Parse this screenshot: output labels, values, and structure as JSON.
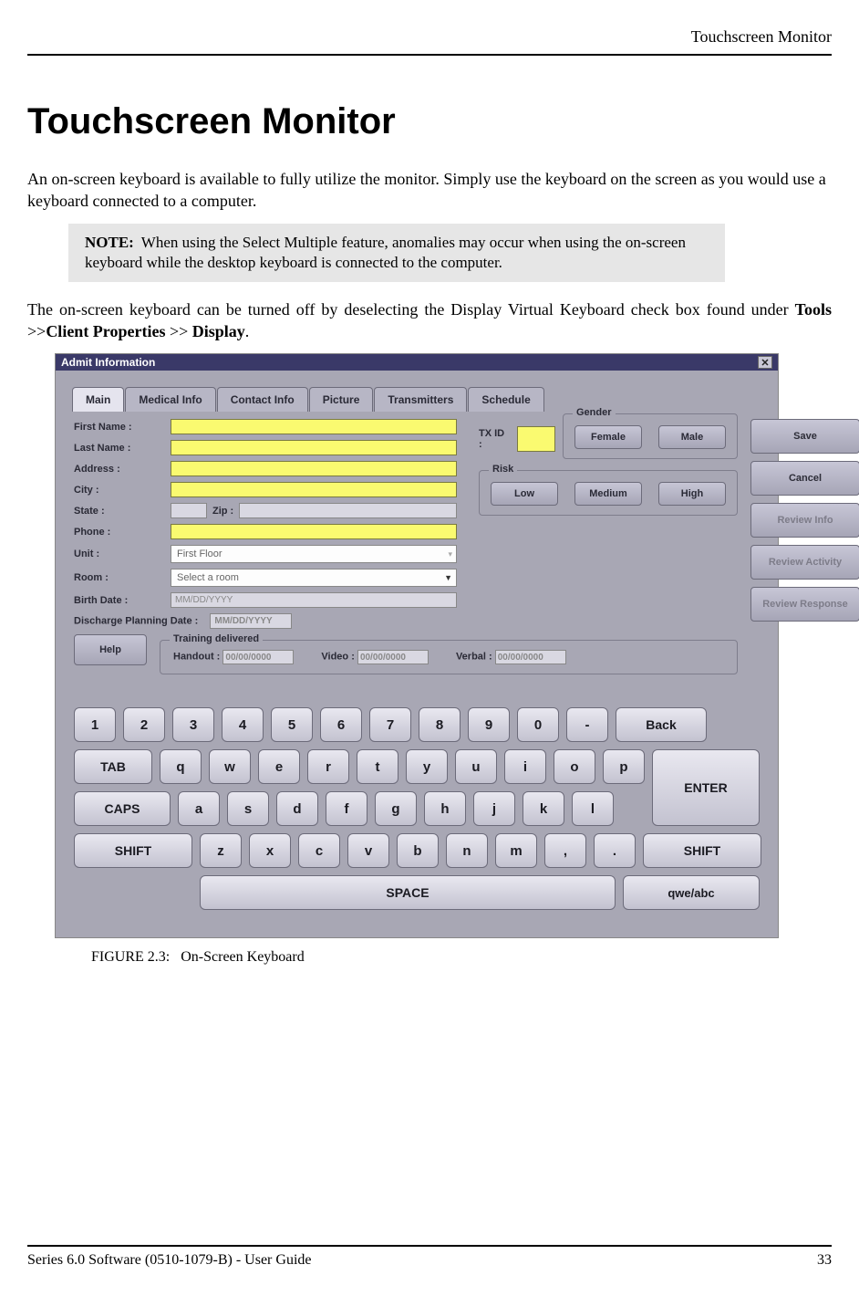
{
  "header": {
    "right": "Touchscreen Monitor"
  },
  "title": "Touchscreen Monitor",
  "intro": "An on-screen keyboard is available to fully utilize the monitor. Simply use the keyboard on the screen as you would use a keyboard connected to a computer.",
  "note": {
    "label": "NOTE:",
    "text": " When using the Select Multiple feature, anomalies may occur when using the on-screen keyboard while the desktop keyboard is connected to the computer."
  },
  "para2": {
    "pre": "The on-screen keyboard can be turned off by deselecting the Display Virtual Keyboard check box found under ",
    "tools": "Tools",
    "sep1": " >>",
    "client": "Client Properties",
    "sep2": " >> ",
    "display": "Display",
    "end": "."
  },
  "shot": {
    "title": "Admit Information",
    "tabs": [
      "Main",
      "Medical Info",
      "Contact Info",
      "Picture",
      "Transmitters",
      "Schedule"
    ],
    "labels": {
      "first": "First Name :",
      "last": "Last Name :",
      "address": "Address :",
      "city": "City :",
      "state": "State :",
      "zip": "Zip :",
      "phone": "Phone :",
      "unit": "Unit :",
      "room": "Room :",
      "birth": "Birth Date :",
      "dpd": "Discharge Planning Date :",
      "txid": "TX ID :"
    },
    "placeholders": {
      "unit": "First Floor",
      "room": "Select a room",
      "birth": "MM/DD/YYYY",
      "dpd": "MM/DD/YYYY"
    },
    "gender": {
      "legend": "Gender",
      "female": "Female",
      "male": "Male"
    },
    "risk": {
      "legend": "Risk",
      "low": "Low",
      "medium": "Medium",
      "high": "High"
    },
    "rbuttons": {
      "save": "Save",
      "cancel": "Cancel",
      "rinfo": "Review Info",
      "ract": "Review Activity",
      "rresp": "Review Response"
    },
    "help": "Help",
    "training": {
      "legend": "Training delivered",
      "handout": "Handout :",
      "video": "Video :",
      "verbal": "Verbal :",
      "ph": "00/00/0000"
    }
  },
  "keys": {
    "row1": [
      "1",
      "2",
      "3",
      "4",
      "5",
      "6",
      "7",
      "8",
      "9",
      "0",
      "-"
    ],
    "back": "Back",
    "tab": "TAB",
    "row2": [
      "q",
      "w",
      "e",
      "r",
      "t",
      "y",
      "u",
      "i",
      "o",
      "p"
    ],
    "enter": "ENTER",
    "caps": "CAPS",
    "row3": [
      "a",
      "s",
      "d",
      "f",
      "g",
      "h",
      "j",
      "k",
      "l"
    ],
    "shift": "SHIFT",
    "row4": [
      "z",
      "x",
      "c",
      "v",
      "b",
      "n",
      "m",
      ",",
      "."
    ],
    "shift2": "SHIFT",
    "space": "SPACE",
    "qwe": "qwe/abc"
  },
  "caption": {
    "label": "FIGURE 2.3:",
    "text": "On-Screen Keyboard"
  },
  "footer": {
    "left": "Series 6.0 Software (0510-1079-B) - User Guide",
    "right": "33"
  }
}
